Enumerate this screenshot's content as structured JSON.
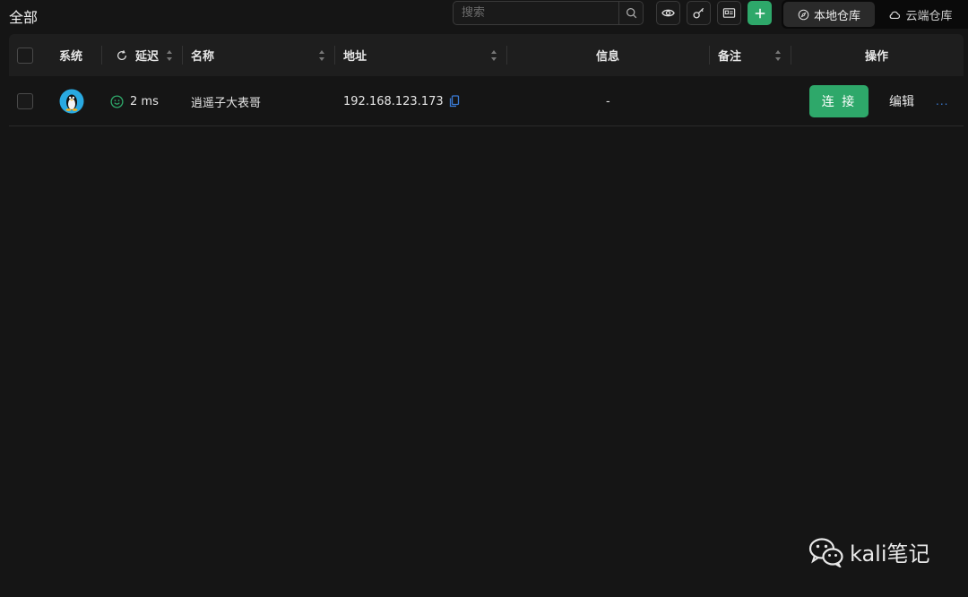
{
  "header": {
    "title": "全部",
    "search": {
      "placeholder": "搜索",
      "value": ""
    },
    "toolbar": {
      "view_icon": "eye-icon",
      "key_icon": "key-icon",
      "id_card_icon": "id-card-icon",
      "add_icon": "plus-icon"
    },
    "source_tabs": [
      {
        "label": "本地仓库",
        "icon": "compass-icon",
        "active": true
      },
      {
        "label": "云端仓库",
        "icon": "cloud-icon",
        "active": false
      }
    ]
  },
  "table": {
    "columns": {
      "system": "系统",
      "latency": "延迟",
      "name": "名称",
      "address": "地址",
      "info": "信息",
      "note": "备注",
      "actions": "操作"
    },
    "rows": [
      {
        "os_icon": "linux-tux-icon",
        "latency": "2 ms",
        "latency_status": "good",
        "name": "逍遥子大表哥",
        "address": "192.168.123.173",
        "info": "-",
        "note": "",
        "connect_label": "连 接",
        "edit_label": "编辑",
        "more_label": "..."
      }
    ]
  },
  "watermark": {
    "text": "kali笔记",
    "icon": "wechat-icon"
  },
  "colors": {
    "accent": "#2ea86a",
    "link": "#3a7bd5",
    "background": "#151515",
    "header": "#1e1e1e"
  }
}
